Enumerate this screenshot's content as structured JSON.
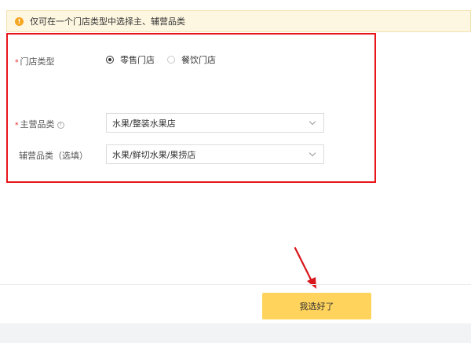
{
  "notice": {
    "icon": "exclamation-circle-icon",
    "text": "仅可在一个门店类型中选择主、辅营品类"
  },
  "form": {
    "store_type": {
      "label": "门店类型",
      "required_mark": "*",
      "options": [
        {
          "label": "零售门店",
          "checked": true
        },
        {
          "label": "餐饮门店",
          "checked": false
        }
      ]
    },
    "main_category": {
      "label": "主营品类",
      "required_mark": "*",
      "help_icon": "question-circle-icon",
      "help_glyph": "?",
      "value": "水果/整装水果店"
    },
    "sub_category": {
      "label": "辅营品类（选填）",
      "value": "水果/鲜切水果/果捞店"
    }
  },
  "confirm_button": {
    "label": "我选好了"
  },
  "colors": {
    "highlight_border": "#e8161a",
    "button": "#ffd35c",
    "notice_bg": "#fdf6e0",
    "arrow": "#d9161b"
  }
}
